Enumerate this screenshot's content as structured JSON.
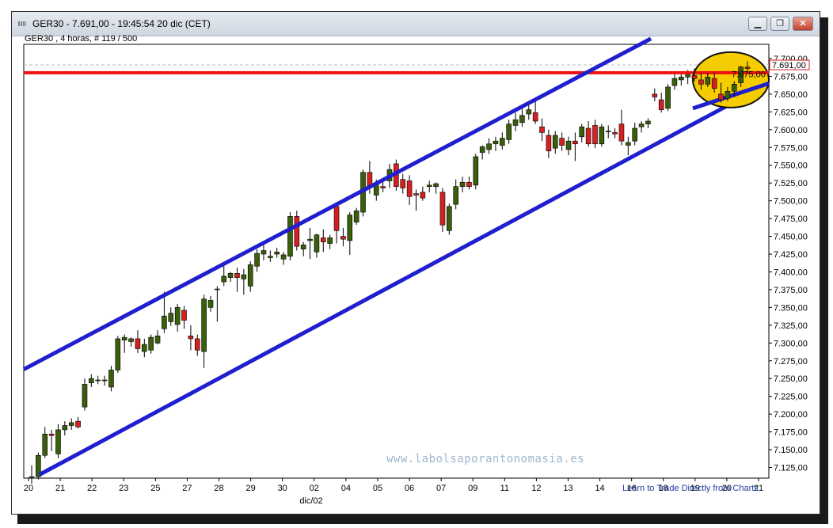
{
  "window": {
    "title": "GER30 - 7.691,00 - 19:45:54  20 dic (CET)",
    "subtitle": "GER30 , 4 horas, # 119 / 500",
    "minimize_icon": "minimize-icon",
    "restore_icon": "restore-icon",
    "close_icon": "close-icon"
  },
  "footer": {
    "link": "Learn to Trade Directly from Charts",
    "month_label": "dic/02",
    "watermark": "www.labolsaporantonomasia.es"
  },
  "colors": {
    "bull": "#3a5f0b",
    "bear": "#d42020",
    "channel": "#1f1fcf",
    "resistance": "#f01010",
    "highlight": "#f5cc00"
  },
  "chart_data": {
    "type": "candlestick",
    "symbol": "GER30",
    "timeframe": "4 horas",
    "last_price": "7.691,00",
    "current_price_label": "7.675,00",
    "ylim": [
      7110,
      7720
    ],
    "y_ticks": [
      "7.700,00",
      "7.675,00",
      "7.650,00",
      "7.625,00",
      "7.600,00",
      "7.575,00",
      "7.550,00",
      "7.525,00",
      "7.500,00",
      "7.475,00",
      "7.450,00",
      "7.425,00",
      "7.400,00",
      "7.375,00",
      "7.350,00",
      "7.325,00",
      "7.300,00",
      "7.275,00",
      "7.250,00",
      "7.225,00",
      "7.200,00",
      "7.175,00",
      "7.150,00",
      "7.125,00"
    ],
    "x_ticks": [
      "20",
      "21",
      "22",
      "23",
      "25",
      "27",
      "28",
      "29",
      "30",
      "02",
      "04",
      "05",
      "06",
      "07",
      "09",
      "11",
      "12",
      "13",
      "14",
      "16",
      "18",
      "19",
      "20",
      "21"
    ],
    "candles": [
      [
        7110,
        7128,
        7102,
        7112
      ],
      [
        7112,
        7146,
        7108,
        7142
      ],
      [
        7142,
        7182,
        7138,
        7172
      ],
      [
        7172,
        7178,
        7148,
        7170
      ],
      [
        7144,
        7186,
        7138,
        7178
      ],
      [
        7178,
        7190,
        7170,
        7184
      ],
      [
        7184,
        7194,
        7178,
        7188
      ],
      [
        7190,
        7196,
        7180,
        7182
      ],
      [
        7210,
        7250,
        7205,
        7242
      ],
      [
        7244,
        7256,
        7238,
        7250
      ],
      [
        7248,
        7254,
        7242,
        7248
      ],
      [
        7248,
        7254,
        7240,
        7248
      ],
      [
        7238,
        7268,
        7232,
        7262
      ],
      [
        7262,
        7310,
        7258,
        7306
      ],
      [
        7304,
        7312,
        7286,
        7308
      ],
      [
        7302,
        7308,
        7295,
        7306
      ],
      [
        7306,
        7318,
        7286,
        7292
      ],
      [
        7288,
        7306,
        7280,
        7298
      ],
      [
        7290,
        7312,
        7285,
        7308
      ],
      [
        7300,
        7318,
        7298,
        7310
      ],
      [
        7320,
        7372,
        7314,
        7338
      ],
      [
        7330,
        7350,
        7324,
        7342
      ],
      [
        7326,
        7355,
        7316,
        7350
      ],
      [
        7346,
        7352,
        7320,
        7332
      ],
      [
        7310,
        7325,
        7290,
        7306
      ],
      [
        7306,
        7312,
        7282,
        7290
      ],
      [
        7288,
        7368,
        7265,
        7362
      ],
      [
        7350,
        7366,
        7344,
        7360
      ],
      [
        7375,
        7380,
        7330,
        7376
      ],
      [
        7386,
        7410,
        7380,
        7394
      ],
      [
        7392,
        7400,
        7386,
        7398
      ],
      [
        7398,
        7406,
        7372,
        7392
      ],
      [
        7390,
        7404,
        7368,
        7396
      ],
      [
        7380,
        7415,
        7372,
        7410
      ],
      [
        7408,
        7432,
        7400,
        7426
      ],
      [
        7425,
        7438,
        7416,
        7430
      ],
      [
        7420,
        7430,
        7414,
        7422
      ],
      [
        7425,
        7434,
        7420,
        7428
      ],
      [
        7418,
        7428,
        7410,
        7424
      ],
      [
        7422,
        7484,
        7416,
        7478
      ],
      [
        7478,
        7486,
        7430,
        7436
      ],
      [
        7432,
        7442,
        7422,
        7438
      ],
      [
        7444,
        7462,
        7418,
        7446
      ],
      [
        7428,
        7454,
        7420,
        7452
      ],
      [
        7448,
        7460,
        7428,
        7442
      ],
      [
        7440,
        7452,
        7432,
        7448
      ],
      [
        7492,
        7496,
        7440,
        7458
      ],
      [
        7450,
        7462,
        7436,
        7446
      ],
      [
        7444,
        7484,
        7424,
        7480
      ],
      [
        7470,
        7490,
        7466,
        7486
      ],
      [
        7484,
        7544,
        7478,
        7540
      ],
      [
        7540,
        7556,
        7510,
        7520
      ],
      [
        7508,
        7530,
        7500,
        7522
      ],
      [
        7520,
        7532,
        7512,
        7518
      ],
      [
        7528,
        7552,
        7518,
        7544
      ],
      [
        7552,
        7558,
        7514,
        7520
      ],
      [
        7530,
        7538,
        7510,
        7518
      ],
      [
        7528,
        7536,
        7494,
        7506
      ],
      [
        7510,
        7516,
        7486,
        7508
      ],
      [
        7512,
        7520,
        7500,
        7504
      ],
      [
        7520,
        7528,
        7512,
        7522
      ],
      [
        7520,
        7526,
        7510,
        7524
      ],
      [
        7512,
        7518,
        7456,
        7466
      ],
      [
        7458,
        7496,
        7452,
        7492
      ],
      [
        7495,
        7530,
        7488,
        7520
      ],
      [
        7520,
        7534,
        7512,
        7526
      ],
      [
        7526,
        7534,
        7516,
        7520
      ],
      [
        7522,
        7566,
        7516,
        7562
      ],
      [
        7568,
        7578,
        7558,
        7576
      ],
      [
        7572,
        7588,
        7566,
        7580
      ],
      [
        7580,
        7590,
        7570,
        7584
      ],
      [
        7578,
        7596,
        7572,
        7588
      ],
      [
        7586,
        7614,
        7580,
        7608
      ],
      [
        7606,
        7624,
        7598,
        7614
      ],
      [
        7610,
        7630,
        7604,
        7620
      ],
      [
        7622,
        7636,
        7614,
        7628
      ],
      [
        7624,
        7642,
        7608,
        7612
      ],
      [
        7604,
        7616,
        7584,
        7596
      ],
      [
        7592,
        7600,
        7560,
        7570
      ],
      [
        7574,
        7598,
        7566,
        7592
      ],
      [
        7588,
        7596,
        7570,
        7578
      ],
      [
        7572,
        7590,
        7564,
        7584
      ],
      [
        7584,
        7596,
        7556,
        7580
      ],
      [
        7590,
        7608,
        7582,
        7604
      ],
      [
        7602,
        7612,
        7576,
        7580
      ],
      [
        7606,
        7614,
        7574,
        7580
      ],
      [
        7580,
        7608,
        7576,
        7604
      ],
      [
        7598,
        7606,
        7588,
        7598
      ],
      [
        7596,
        7602,
        7588,
        7594
      ],
      [
        7608,
        7628,
        7578,
        7584
      ],
      [
        7578,
        7590,
        7564,
        7582
      ],
      [
        7584,
        7610,
        7578,
        7602
      ],
      [
        7604,
        7612,
        7596,
        7608
      ],
      [
        7608,
        7616,
        7602,
        7612
      ],
      [
        7650,
        7658,
        7640,
        7646
      ],
      [
        7642,
        7652,
        7624,
        7628
      ],
      [
        7630,
        7664,
        7626,
        7660
      ],
      [
        7662,
        7678,
        7656,
        7672
      ],
      [
        7670,
        7680,
        7662,
        7674
      ],
      [
        7674,
        7684,
        7664,
        7678
      ],
      [
        7676,
        7686,
        7668,
        7672
      ],
      [
        7670,
        7680,
        7656,
        7664
      ],
      [
        7664,
        7680,
        7660,
        7674
      ],
      [
        7672,
        7680,
        7652,
        7658
      ],
      [
        7650,
        7666,
        7638,
        7642
      ],
      [
        7644,
        7660,
        7640,
        7654
      ],
      [
        7654,
        7668,
        7646,
        7664
      ],
      [
        7666,
        7690,
        7660,
        7688
      ],
      [
        7688,
        7696,
        7680,
        7686
      ]
    ]
  }
}
